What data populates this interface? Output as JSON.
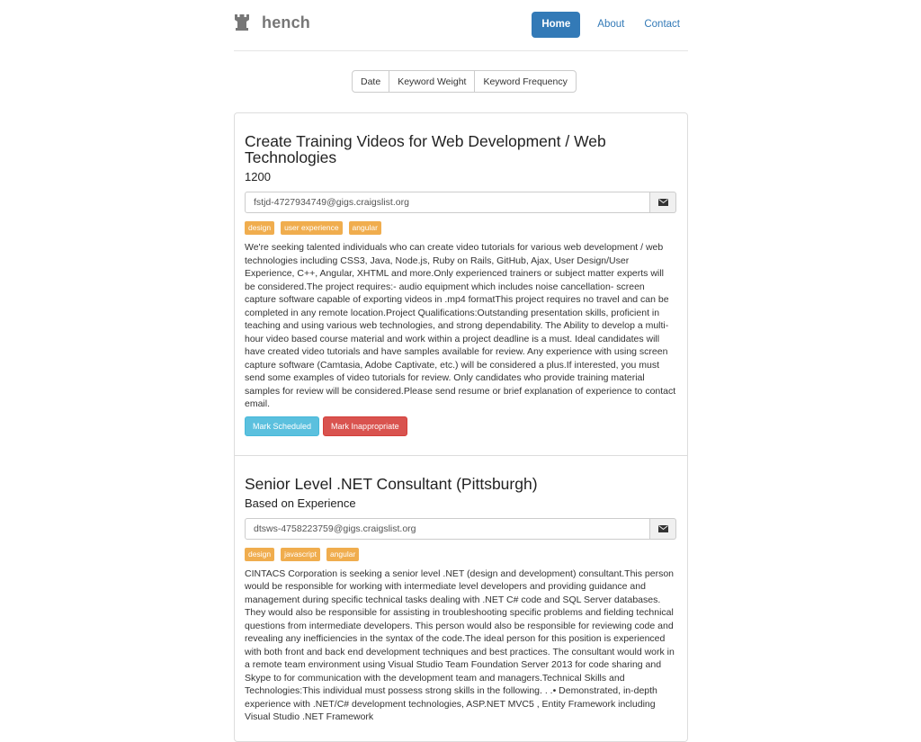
{
  "brand": {
    "name": "hench",
    "icon": "rook-icon"
  },
  "nav": {
    "home": "Home",
    "about": "About",
    "contact": "Contact",
    "active": "Home"
  },
  "sort": {
    "date": "Date",
    "keyword_weight": "Keyword Weight",
    "keyword_frequency": "Keyword Frequency"
  },
  "colors": {
    "primary": "#337ab7",
    "tag": "#f0ad4e",
    "info": "#5bc0de",
    "danger": "#d9534f"
  },
  "jobs": [
    {
      "title": "Create Training Videos for Web Development / Web Technologies",
      "pay": "1200",
      "email": "fstjd-4727934749@gigs.craigslist.org",
      "tags": [
        "design",
        "user experience",
        "angular"
      ],
      "description": "We're seeking talented individuals who can create video tutorials for various web development / web technologies including CSS3, Java, Node.js, Ruby on Rails, GitHub, Ajax, User Design/User Experience, C++, Angular, XHTML and more.Only experienced trainers or subject matter experts will be considered.The project requires:- audio equipment which includes noise cancellation- screen capture software capable of exporting videos in .mp4 formatThis project requires no travel and can be completed in any remote location.Project Qualifications:Outstanding presentation skills, proficient in teaching and using various web technologies, and strong dependability. The Ability to develop a multi-hour video based course material and work within a project deadline is a must. Ideal candidates will have created video tutorials and have samples available for review. Any experience with using screen capture software (Camtasia, Adobe Captivate, etc.) will be considered a plus.If interested, you must send some examples of video tutorials for review. Only candidates who provide training material samples for review will be considered.Please send resume or brief explanation of experience to contact email.",
      "mark_scheduled": "Mark Scheduled",
      "mark_inappropriate": "Mark Inappropriate"
    },
    {
      "title": "Senior Level .NET Consultant (Pittsburgh)",
      "pay": "Based on Experience",
      "email": "dtsws-4758223759@gigs.craigslist.org",
      "tags": [
        "design",
        "javascript",
        "angular"
      ],
      "description": "CINTACS Corporation is seeking a senior level .NET (design and development) consultant.This person would be responsible for working with intermediate level developers and providing guidance and management during specific technical tasks dealing with .NET C# code and SQL Server databases. They would also be responsible for assisting in troubleshooting specific problems and fielding technical questions from intermediate developers. This person would also be responsible for reviewing code and revealing any inefficiencies in the syntax of the code.The ideal person for this position is experienced with both front and back end development techniques and best practices. The consultant would work in a remote team environment using Visual Studio Team Foundation Server 2013 for code sharing and Skype to for communication with the development team and managers.Technical Skills and Technologies:This individual must possess strong skills in the following. . .• Demonstrated, in-depth experience with .NET/C# development technologies, ASP.NET MVC5 , Entity Framework including Visual Studio .NET Framework"
    }
  ]
}
